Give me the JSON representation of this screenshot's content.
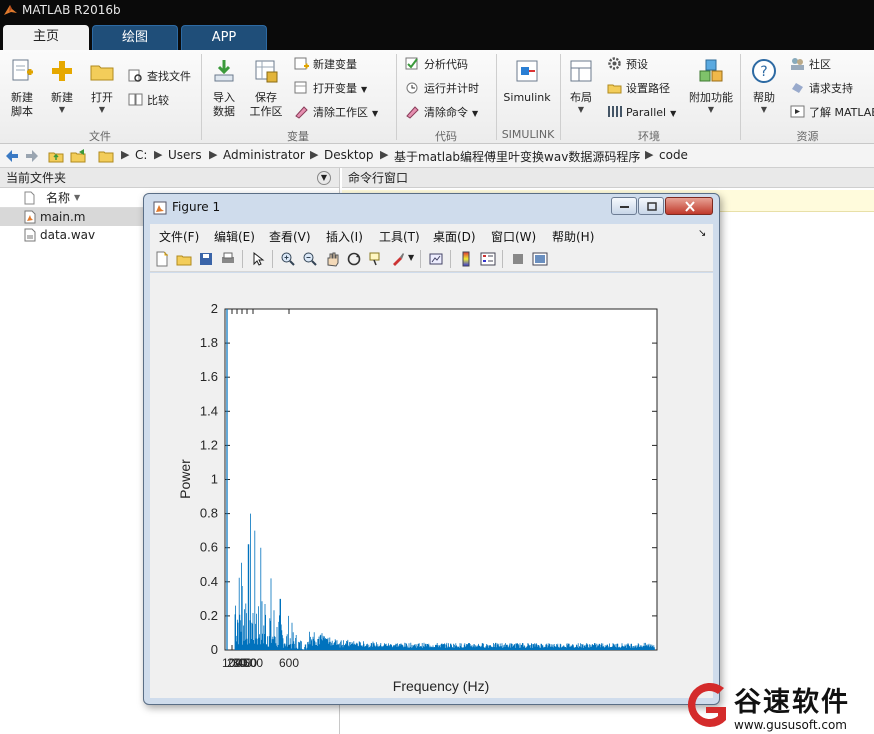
{
  "app": {
    "title": "MATLAB R2016b"
  },
  "tabs": [
    {
      "label": "主页",
      "active": true
    },
    {
      "label": "绘图",
      "active": false
    },
    {
      "label": "APP",
      "active": false
    }
  ],
  "ribbon": {
    "file": {
      "group_label": "文件",
      "new_script": "新建\n脚本",
      "new": "新建",
      "open": "打开",
      "find_files": "查找文件",
      "compare": "比较"
    },
    "variable": {
      "group_label": "变量",
      "import": "导入\n数据",
      "save_workspace": "保存\n工作区",
      "new_variable": "新建变量",
      "open_variable": "打开变量",
      "clear_workspace": "清除工作区"
    },
    "code": {
      "group_label": "代码",
      "analyze": "分析代码",
      "run_time": "运行并计时",
      "clear_commands": "清除命令"
    },
    "simulink": {
      "group_label": "SIMULINK",
      "simulink": "Simulink"
    },
    "environment": {
      "group_label": "环境",
      "layout": "布局",
      "preferences": "预设",
      "set_path": "设置路径",
      "parallel": "Parallel",
      "addons": "附加功能"
    },
    "resources": {
      "group_label": "资源",
      "help": "帮助",
      "community": "社区",
      "request_support": "请求支持",
      "learn_matlab": "了解 MATLAB"
    }
  },
  "address": {
    "crumbs": [
      "C:",
      "Users",
      "Administrator",
      "Desktop",
      "基于matlab编程傅里叶变换wav数据源码程序",
      "code"
    ]
  },
  "current_folder": {
    "title": "当前文件夹",
    "column_name": "名称",
    "files": [
      {
        "name": "main.m",
        "selected": true
      },
      {
        "name": "data.wav",
        "selected": false
      }
    ]
  },
  "command_window": {
    "title": "命令行窗口"
  },
  "figure": {
    "title": "Figure 1",
    "menus": [
      "文件(F)",
      "编辑(E)",
      "查看(V)",
      "插入(I)",
      "工具(T)",
      "桌面(D)",
      "窗口(W)",
      "帮助(H)"
    ],
    "menu_arrow": "↘"
  },
  "chart_data": {
    "type": "line",
    "title": "",
    "xlabel": "Frequency (Hz)",
    "ylabel": "Power",
    "ylim": [
      0,
      2
    ],
    "yticks": [
      0,
      0.2,
      0.4,
      0.6,
      0.8,
      1,
      1.2,
      1.4,
      1.6,
      1.8,
      2
    ],
    "xtick_labels": [
      "100",
      "200",
      "300",
      "400",
      "500",
      "600"
    ],
    "x_peak_region": [
      20,
      130
    ],
    "peak_values": [
      0.9,
      0.86,
      0.8,
      0.7,
      0.6,
      0.5,
      0.4,
      0.3
    ],
    "noise_floor": 0.03,
    "series": [
      {
        "color": "#0072bd",
        "values": [
          0.82,
          0.6,
          0.9,
          0.55,
          0.86,
          0.62,
          0.8,
          0.5,
          0.7,
          0.46,
          0.6,
          0.4,
          0.5,
          0.36,
          0.42,
          0.3,
          0.36,
          0.26,
          0.3,
          0.22,
          0.25,
          0.18,
          0.2,
          0.16,
          0.15,
          0.12,
          0.1,
          0.08,
          0.06,
          0.05
        ]
      }
    ]
  },
  "watermark": {
    "brand": "谷速软件",
    "url": "www.gususoft.com",
    "color": "#d42b2b"
  }
}
